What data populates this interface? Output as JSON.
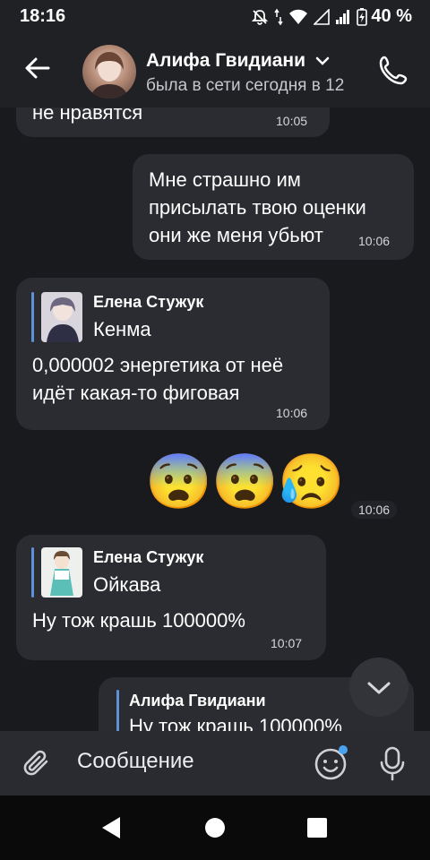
{
  "status": {
    "time": "18:16",
    "battery": "40 %"
  },
  "header": {
    "name": "Алифа Гвидиани",
    "status": "была в сети сегодня в 12"
  },
  "messages": {
    "m1": {
      "text": "не нравятся",
      "time": "10:05"
    },
    "m2": {
      "lines": [
        "Мне страшно им",
        "присылать твою оценки",
        "они же меня убьют"
      ],
      "time": "10:06"
    },
    "m3": {
      "quote_author": "Елена Стужук",
      "quote_text": "Кенма",
      "lines": [
        "0,000002 энергетика от неё",
        "идёт какая-то фиговая"
      ],
      "time": "10:06"
    },
    "m4": {
      "emojis": [
        "😨",
        "😨",
        "😥"
      ],
      "time": "10:06"
    },
    "m5": {
      "quote_author": "Елена Стужук",
      "quote_text": "Ойкава",
      "text": "Ну тож крашь 100000%",
      "time": "10:07"
    },
    "m6": {
      "quote_author": "Алифа Гвидиани",
      "quote_text": "Ну тож крашь 100000%"
    }
  },
  "input": {
    "placeholder": "Сообщение"
  },
  "colors": {
    "background": "#191a1e",
    "bubble": "#2b2c31",
    "quote_accent": "#5f91d8",
    "unread_dot": "#4aa3f0"
  }
}
